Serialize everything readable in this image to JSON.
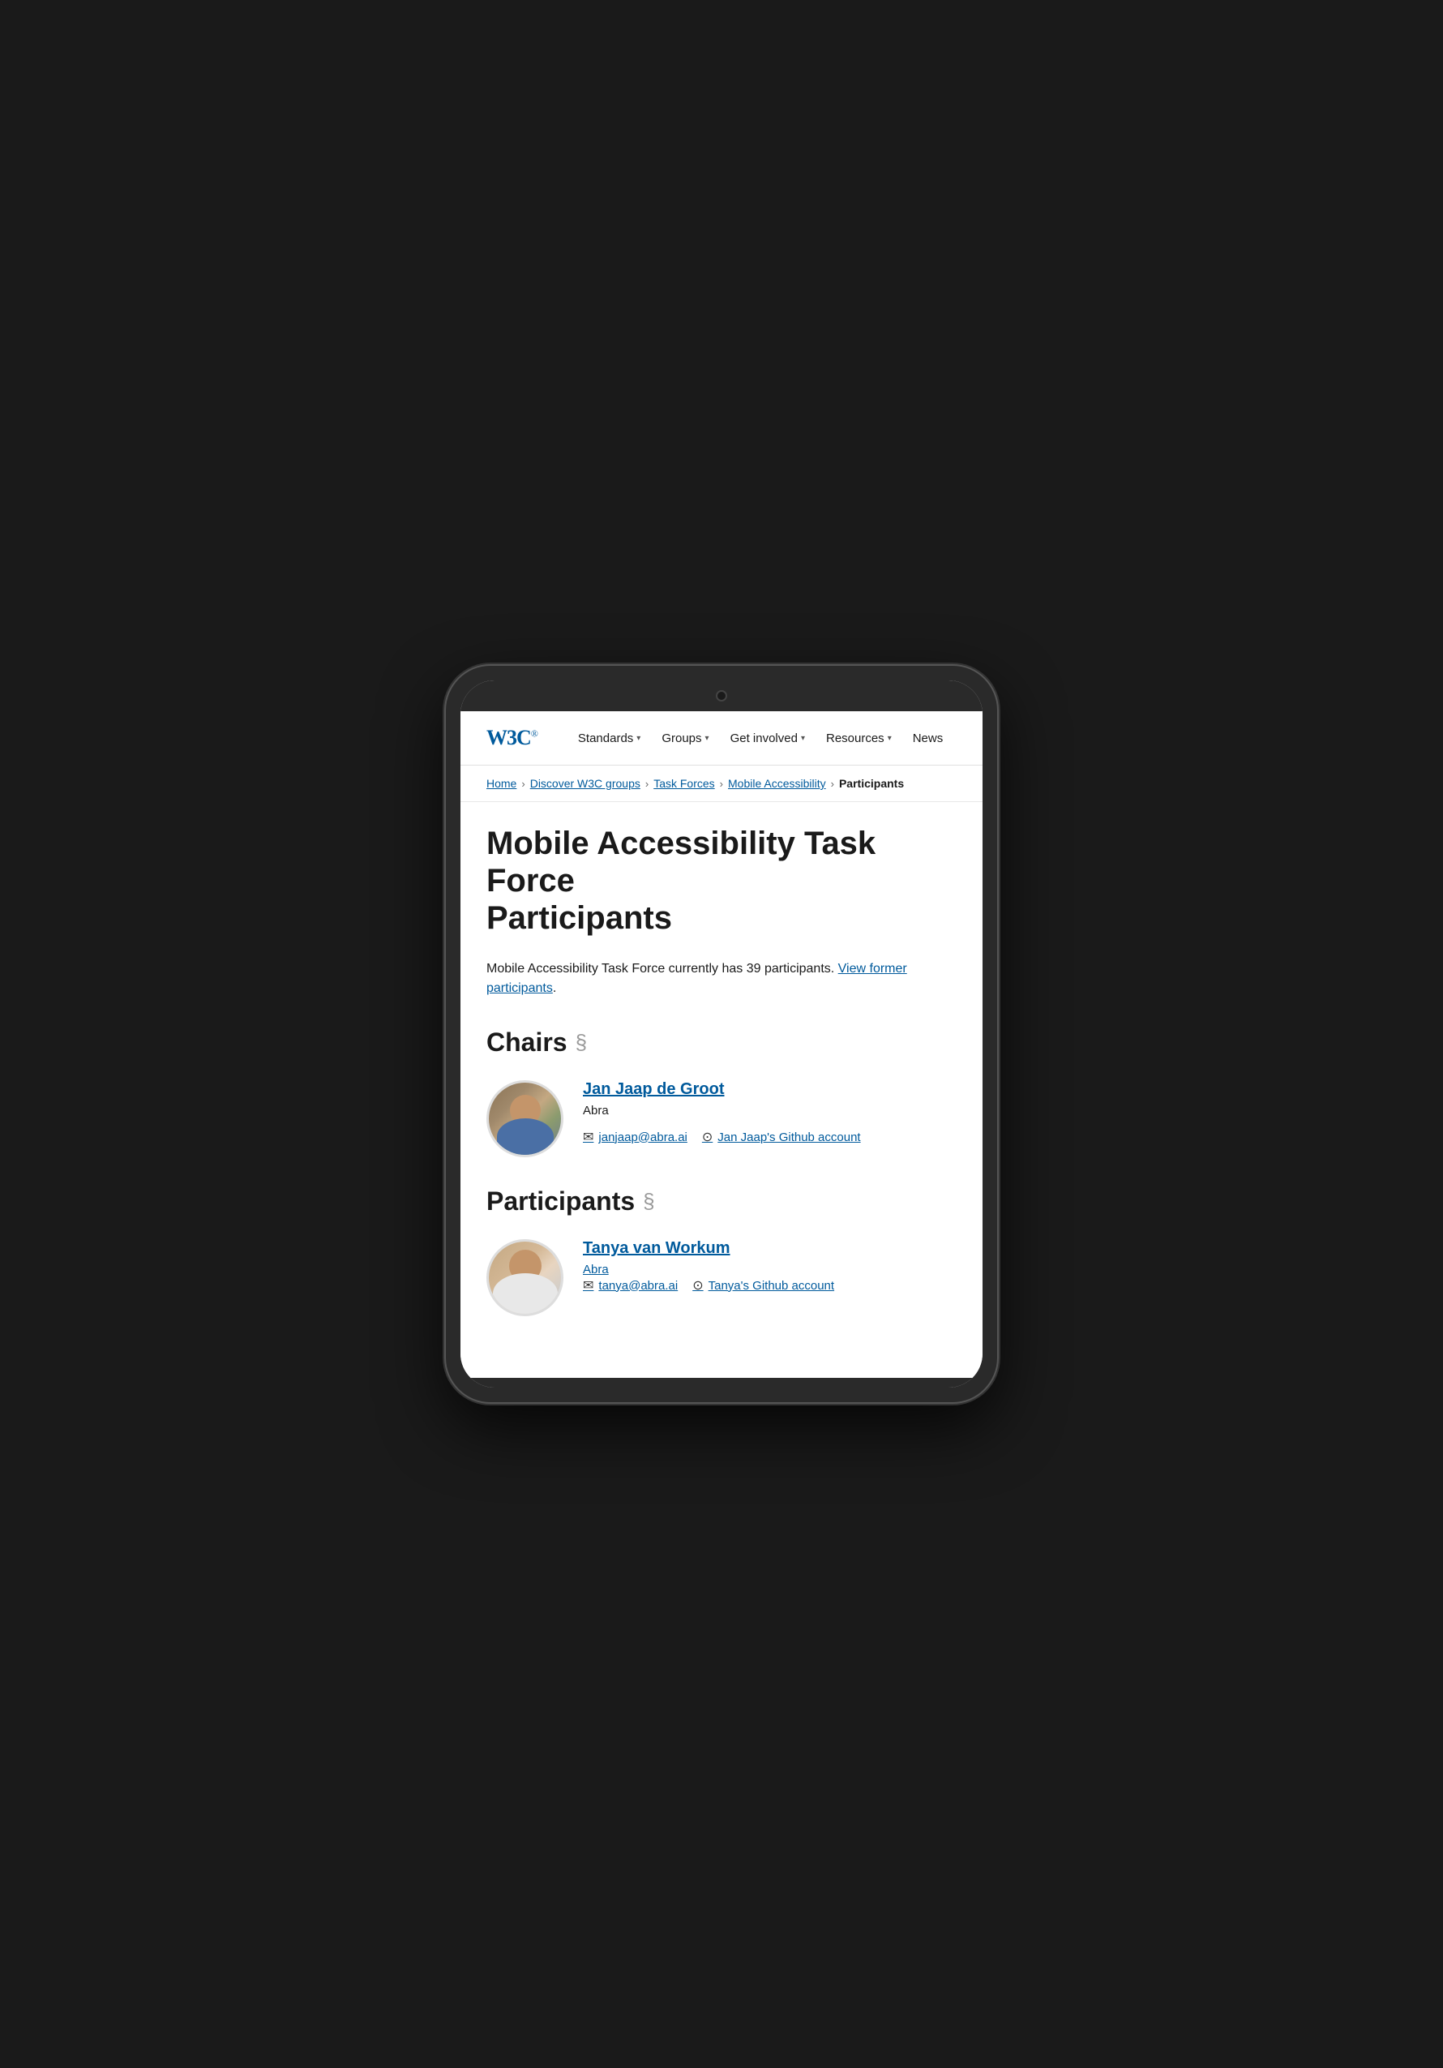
{
  "nav": {
    "logo": "W3C",
    "logo_reg": "®",
    "items": [
      {
        "label": "Standards",
        "has_dropdown": true
      },
      {
        "label": "Groups",
        "has_dropdown": true
      },
      {
        "label": "Get involved",
        "has_dropdown": true
      },
      {
        "label": "Resources",
        "has_dropdown": true
      },
      {
        "label": "News",
        "has_dropdown": false
      }
    ]
  },
  "breadcrumb": {
    "items": [
      {
        "label": "Home",
        "is_link": true
      },
      {
        "label": "Discover W3C groups",
        "is_link": true
      },
      {
        "label": "Task Forces",
        "is_link": true
      },
      {
        "label": "Mobile Accessibility",
        "is_link": true
      },
      {
        "label": "Participants",
        "is_link": false
      }
    ]
  },
  "page": {
    "title_line1": "Mobile Accessibility Task Force",
    "title_line2": "Participants",
    "participant_count_text": "Mobile Accessibility Task Force currently has 39 participants.",
    "view_former_link": "View former participants",
    "period": "."
  },
  "chairs_section": {
    "heading": "Chairs",
    "symbol": "§",
    "people": [
      {
        "name": "Jan Jaap de Groot",
        "org": "Abra",
        "org_is_link": false,
        "email": "janjaap@abra.ai",
        "github_label": "Jan Jaap's Github account",
        "avatar_type": "jan"
      }
    ]
  },
  "participants_section": {
    "heading": "Participants",
    "symbol": "§",
    "people": [
      {
        "name": "Tanya van Workum",
        "org": "Abra",
        "org_is_link": true,
        "email": "tanya@abra.ai",
        "github_label": "Tanya's Github account",
        "avatar_type": "tanya"
      }
    ]
  }
}
